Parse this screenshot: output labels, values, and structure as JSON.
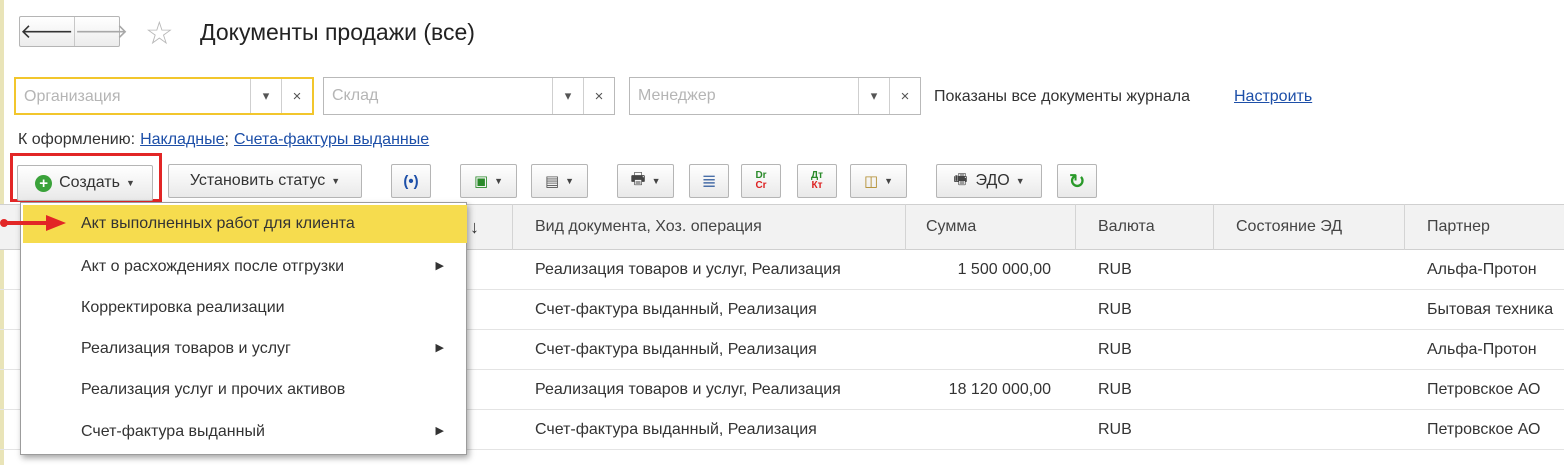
{
  "window": {
    "title": "Документы продажи (все)"
  },
  "nav": {
    "back_glyph": "🡐",
    "forward_glyph": "🡒"
  },
  "filters": {
    "organization_placeholder": "Организация",
    "warehouse_placeholder": "Склад",
    "manager_placeholder": "Менеджер",
    "status_text": "Показаны все документы журнала",
    "setup_link": "Настроить"
  },
  "todo": {
    "label": "К оформлению:",
    "links": [
      "Накладные",
      "Счета-фактуры выданные"
    ],
    "separator": ";"
  },
  "toolbar": {
    "create_label": "Создать",
    "set_status_label": "Установить статус",
    "edo_label": "ЭДО",
    "dr_top": "Dr",
    "dr_bottom": "Cr",
    "dt_top": "Дт",
    "dt_bottom": "Кт"
  },
  "create_menu": {
    "items": [
      {
        "label": "Акт выполненных работ для клиента",
        "submenu": false
      },
      {
        "label": "Акт о расхождениях после отгрузки",
        "submenu": true
      },
      {
        "label": "Корректировка реализации",
        "submenu": false
      },
      {
        "label": "Реализация товаров и услуг",
        "submenu": true
      },
      {
        "label": "Реализация услуг и прочих активов",
        "submenu": false
      },
      {
        "label": "Счет-фактура выданный",
        "submenu": true
      }
    ]
  },
  "table": {
    "sort_indicator": "↓",
    "columns": [
      "Вид документа, Хоз. операция",
      "Сумма",
      "Валюта",
      "Состояние ЭД",
      "Партнер"
    ],
    "rows": [
      {
        "type": "Реализация товаров и услуг, Реализация",
        "sum": "1 500 000,00",
        "currency": "RUB",
        "ed_state": "",
        "partner": "Альфа-Протон"
      },
      {
        "type": "Счет-фактура выданный, Реализация",
        "sum": "",
        "currency": "RUB",
        "ed_state": "",
        "partner": "Бытовая техника"
      },
      {
        "type": "Счет-фактура выданный, Реализация",
        "sum": "",
        "currency": "RUB",
        "ed_state": "",
        "partner": "Альфа-Протон"
      },
      {
        "type": "Реализация товаров и услуг, Реализация",
        "sum": "18 120 000,00",
        "currency": "RUB",
        "ed_state": "",
        "partner": "Петровское АО"
      },
      {
        "type": "Счет-фактура выданный, Реализация",
        "sum": "",
        "currency": "RUB",
        "ed_state": "",
        "partner": "Петровское АО"
      }
    ]
  },
  "colors": {
    "accent": "#f6dc4e",
    "focus_border": "#f2c62c",
    "highlight_frame": "#e22626",
    "link": "#1d4fa8"
  }
}
